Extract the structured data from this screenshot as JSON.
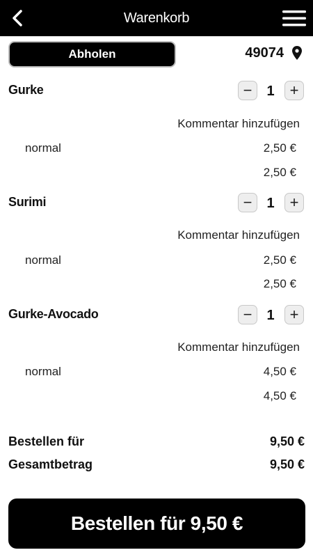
{
  "header": {
    "title": "Warenkorb",
    "back_icon": "chevron-left-icon",
    "menu_icon": "hamburger-menu-icon"
  },
  "pickup": {
    "button_label": "Abholen",
    "zip": "49074",
    "location_icon": "map-pin-icon"
  },
  "items": [
    {
      "name": "Gurke",
      "quantity": "1",
      "decrement_label": "−",
      "increment_label": "+",
      "comment_link": "Kommentar hinzufügen",
      "variant": "normal",
      "variant_price": "2,50 €",
      "item_total": "2,50 €"
    },
    {
      "name": "Surimi",
      "quantity": "1",
      "decrement_label": "−",
      "increment_label": "+",
      "comment_link": "Kommentar hinzufügen",
      "variant": "normal",
      "variant_price": "2,50 €",
      "item_total": "2,50 €"
    },
    {
      "name": "Gurke-Avocado",
      "quantity": "1",
      "decrement_label": "−",
      "increment_label": "+",
      "comment_link": "Kommentar hinzufügen",
      "variant": "normal",
      "variant_price": "4,50 €",
      "item_total": "4,50 €"
    }
  ],
  "totals": {
    "order_for_label": "Bestellen für",
    "order_for_value": "9,50 €",
    "grand_total_label": "Gesamtbetrag",
    "grand_total_value": "9,50 €"
  },
  "order_button": {
    "label": "Bestellen für 9,50 €"
  },
  "colors": {
    "header_bg": "#000000",
    "button_bg": "#000000",
    "qty_button_bg": "#eeeeee"
  }
}
